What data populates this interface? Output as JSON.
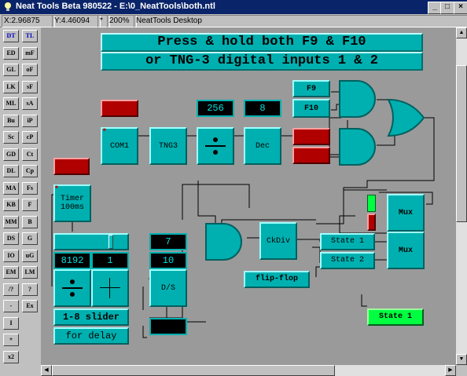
{
  "window": {
    "title": "Neat Tools Beta 980522 - E:\\0_NeatTools\\both.ntl"
  },
  "status": {
    "x": "X:2.96875",
    "y": "Y:4.46094",
    "marker": "*",
    "zoom": "200%",
    "desktop": "NeatTools Desktop"
  },
  "palette": [
    [
      "DT",
      "TL"
    ],
    [
      "ED",
      "mF"
    ],
    [
      "GL",
      "oF"
    ],
    [
      "LK",
      "sF"
    ],
    [
      "ML",
      "sA"
    ],
    [
      "Bu",
      "iP"
    ],
    [
      "Sc",
      "cP"
    ],
    [
      "GD",
      "Ct"
    ],
    [
      "DL",
      "Cp"
    ],
    [
      "MA",
      "Fs"
    ],
    [
      "KB",
      "F"
    ],
    [
      "MM",
      "B"
    ],
    [
      "DS",
      "G"
    ],
    [
      "IO",
      "uG"
    ],
    [
      "EM",
      "LM"
    ],
    [
      "/?",
      "?"
    ],
    [
      "-",
      "Ex"
    ],
    [
      "I",
      ""
    ],
    [
      "+",
      ""
    ],
    [
      "x2",
      ""
    ]
  ],
  "banner": {
    "line1": "Press & hold both F9 & F10",
    "line2": "or TNG-3 digital inputs 1 & 2"
  },
  "modules": {
    "f9": "F9",
    "f10": "F10",
    "com1": "COM1",
    "tng3": "TNG3",
    "dec": "Dec",
    "timer_line1": "Timer",
    "timer_line2": "100ms",
    "ckdiv": "CkDiv",
    "ds": "D/S",
    "state1_in": "State 1",
    "state2_in": "State 2",
    "mux1": "Mux",
    "mux2": "Mux",
    "flipflop": "flip-flop",
    "state_out": "State 1",
    "slider": "1-8 slider",
    "delay": "for delay"
  },
  "displays": {
    "val256": "256",
    "val8": "8",
    "val8192": "8192",
    "val1": "1",
    "val7": "7",
    "val10": "10"
  },
  "colors": {
    "canvas": "#9a9a9a",
    "module": "#00b0b0",
    "active_red": "#b00000",
    "active_green": "#00ff40",
    "titlebar": "#0a246a"
  },
  "icons": [
    "app-icon",
    "minimize-icon",
    "maximize-icon",
    "close-icon",
    "and-gate-icon",
    "or-gate-icon",
    "divide-icon",
    "plus-icon",
    "scroll-up-icon",
    "scroll-down-icon",
    "scroll-left-icon",
    "scroll-right-icon"
  ]
}
